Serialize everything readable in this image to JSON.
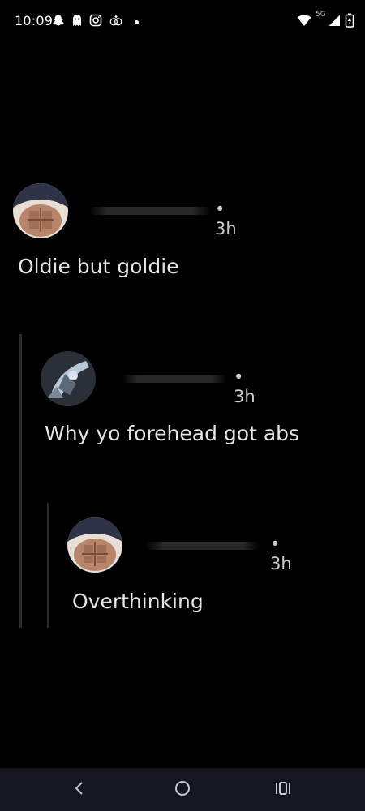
{
  "status_bar": {
    "time": "10:09",
    "icons_left": [
      "snapchat-icon",
      "ghost-icon",
      "instagram-icon",
      "rings-icon"
    ],
    "network_label": "5G",
    "icons_right": [
      "wifi-icon",
      "signal-icon",
      "battery-icon"
    ]
  },
  "thread": {
    "comments": [
      {
        "time": "• 3h",
        "text": "Oldie but goldie"
      },
      {
        "time": "• 3h",
        "text": "Why yo forehead got abs"
      },
      {
        "time": "• 3h",
        "text": "Overthinking"
      }
    ]
  },
  "nav_bar": {
    "buttons": [
      "back-icon",
      "home-icon",
      "recents-icon"
    ]
  },
  "colors": {
    "background": "#000000",
    "text": "#e6e6e6",
    "timestamp": "#cccccc",
    "thread_line": "#2c2c2c",
    "nav_bar": "#15161e"
  }
}
